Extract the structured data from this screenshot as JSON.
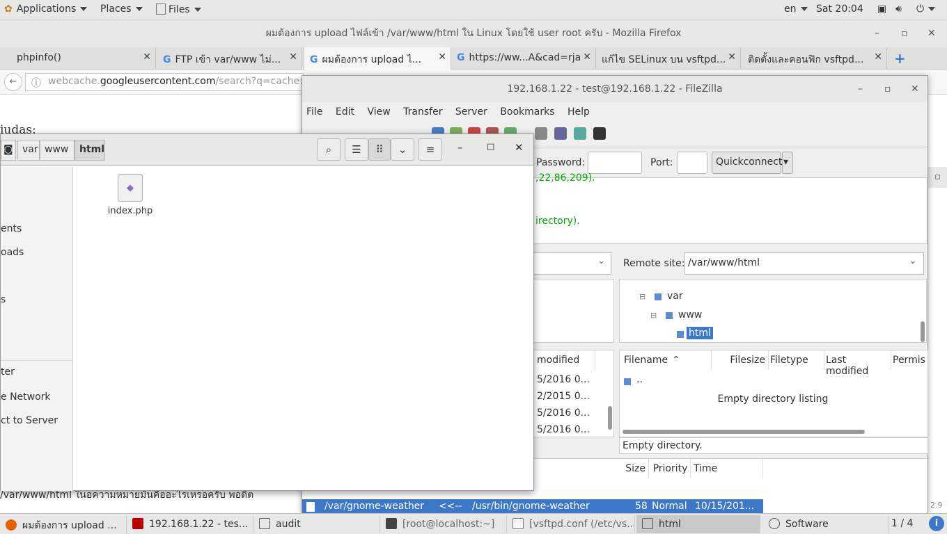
{
  "topbar": {
    "applications": "Applications",
    "places": "Places",
    "files": "Files",
    "lang": "en",
    "clock": "Sat 20:04"
  },
  "firefox": {
    "title": "ผมต้องการ upload ไฟล์เข้า /var/www/html ใน Linux โดยใช้ user root ครับ - Mozilla Firefox",
    "tabs": [
      "phpinfo()",
      "FTP เข้า var/www ไม่...",
      "ผมต้องการ upload ไ...",
      "https://ww...A&cad=rja",
      "แก้ไข SELinux บน vsftpd...",
      "ติดตั้งและคอนฟิก vsftpd..."
    ],
    "url_pre": "webcache.",
    "url_domain": "googleusercontent.com",
    "url_post": "/search?q=cache:ULD",
    "page_snippet": "iudas:",
    "page_bottom": "/var/www/html ในอความหมายมันคืออะไรเหรอครับ พอดีต"
  },
  "filezilla": {
    "title": "192.168.1.22 - test@192.168.1.22 - FileZilla",
    "menu": [
      "File",
      "Edit",
      "View",
      "Transfer",
      "Server",
      "Bookmarks",
      "Help"
    ],
    "password_label": "Password:",
    "port_label": "Port:",
    "quickconnect": "Quickconnect",
    "log": [
      ",22,86,209).",
      "irectory)."
    ],
    "remote_site_label": "Remote site:",
    "remote_path": "/var/www/html",
    "tree": [
      "var",
      "www",
      "html"
    ],
    "local_col": "modified",
    "local_dates": [
      "5/2016 0...",
      "2/2015 0...",
      "5/2016 0...",
      "5/2016 0..."
    ],
    "remote_cols": [
      "Filename",
      "Filesize",
      "Filetype",
      "Last modified",
      "Permis"
    ],
    "parent_dir": "..",
    "empty_listing": "Empty directory listing",
    "status": "Empty directory.",
    "queue_cols": [
      "Size",
      "Priority",
      "Time"
    ],
    "queue_row": {
      "local": "/var/gnome-weather",
      "dir": "<<--",
      "remote": "/usr/bin/gnome-weather",
      "size": "58",
      "priority": "Normal",
      "time": "10/15/201..."
    }
  },
  "nautilus": {
    "crumbs": [
      "var",
      "www",
      "html"
    ],
    "sidebar": [
      "ents",
      "oads",
      "s",
      "ter",
      "e Network",
      "ct to Server"
    ],
    "file": "index.php"
  },
  "taskbar": {
    "items": [
      "ผมต้องการ upload ...",
      "192.168.1.22 - tes...",
      "audit",
      "[root@localhost:~]",
      "[vsftpd.conf (/etc/vs...",
      "html",
      "Software"
    ],
    "pager": "1 / 4"
  }
}
